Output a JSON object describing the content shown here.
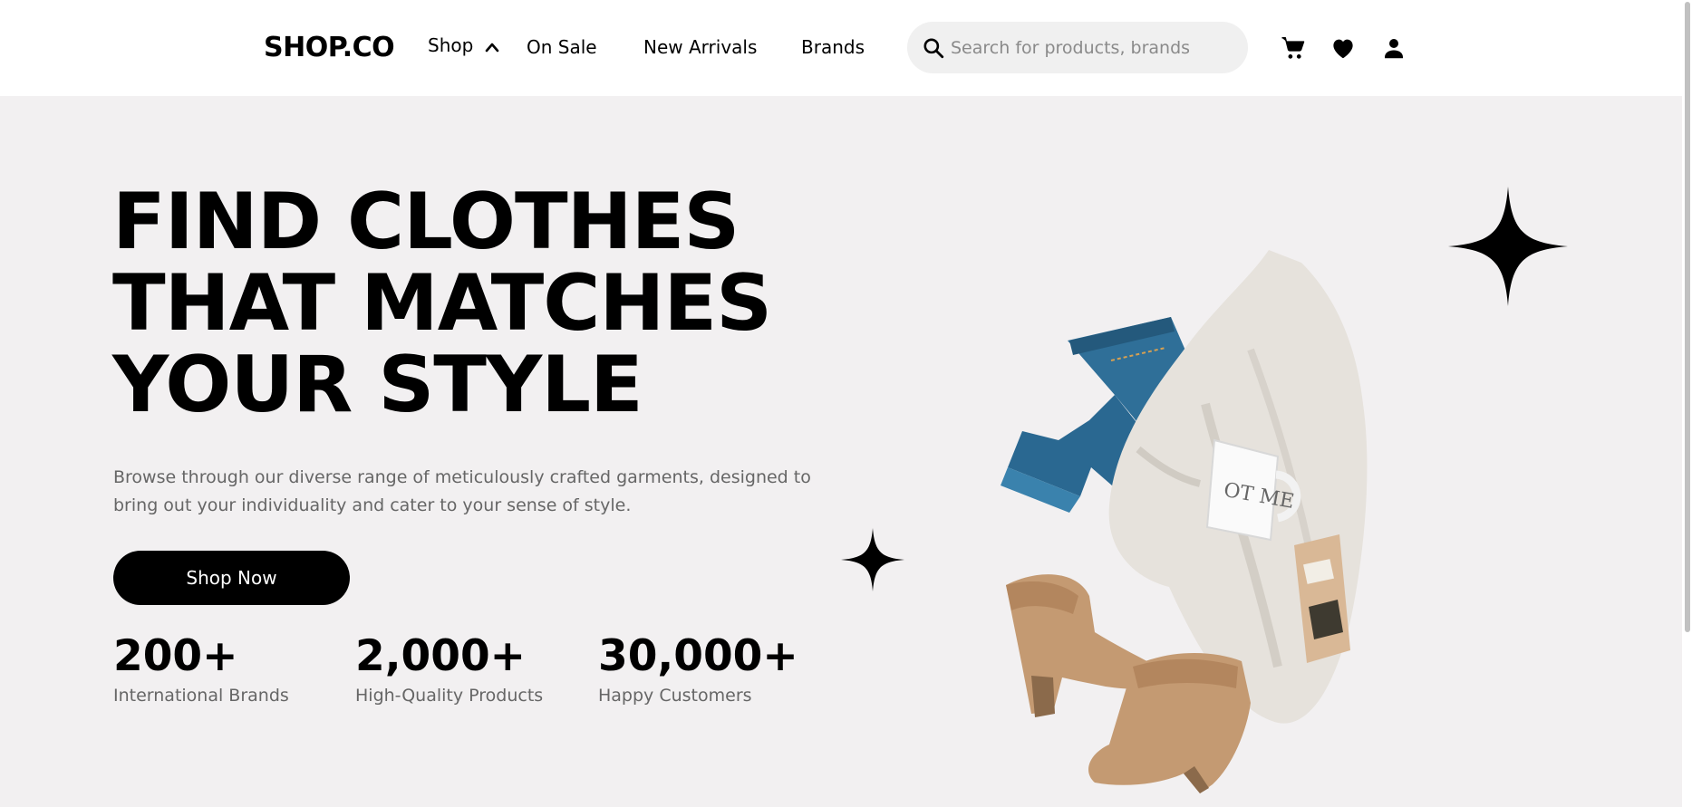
{
  "header": {
    "logo": "SHOP.CO",
    "nav": {
      "shop": "Shop",
      "on_sale": "On Sale",
      "new_arrivals": "New Arrivals",
      "brands": "Brands"
    },
    "search": {
      "placeholder": "Search for products, brands",
      "value": ""
    },
    "icons": [
      "search-icon",
      "chevron-up-icon",
      "cart-icon",
      "heart-icon",
      "user-icon"
    ]
  },
  "hero": {
    "headline": [
      "FIND CLOTHES",
      "THAT MATCHES",
      "YOUR STYLE"
    ],
    "subtext": "Browse through our diverse range of meticulously crafted garments, designed to bring out your individuality and cater to your sense of style.",
    "cta": "Shop Now",
    "stats": [
      {
        "value": "200+",
        "label": "International Brands"
      },
      {
        "value": "2,000+",
        "label": "High-Quality Products"
      },
      {
        "value": "30,000+",
        "label": "Happy Customers"
      }
    ],
    "image": "clothes-flatlay"
  },
  "colors": {
    "hero_background": "#f2f0f1",
    "primary": "#000000",
    "muted_text": "#666666",
    "search_background": "#f0f0f0"
  }
}
